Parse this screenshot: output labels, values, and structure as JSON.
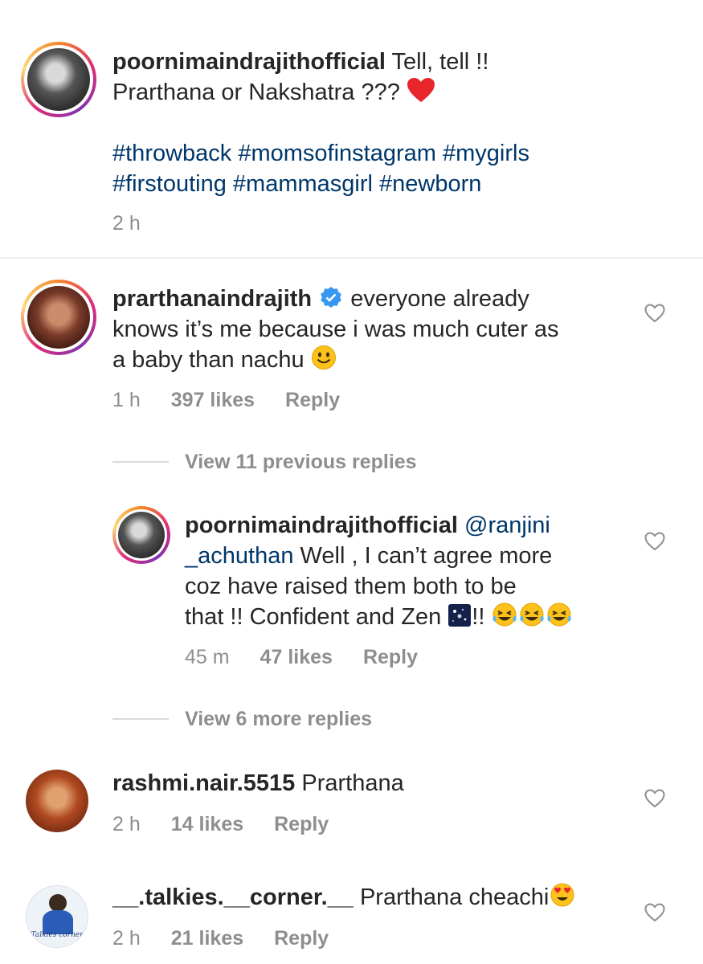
{
  "caption": {
    "username": "poornimaindrajithofficial",
    "text_line1": "Tell, tell !!",
    "text_line2": "Prarthana or Nakshatra ???",
    "hashtags_line1": "#throwback #momsofinstagram #mygirls",
    "hashtags_line2": "#firstouting #mammasgirl #newborn",
    "time": "2 h"
  },
  "comments": [
    {
      "username": "prarthanaindrajith",
      "verified": true,
      "line1": "everyone already",
      "line2": "knows it’s me because i was much cuter as",
      "line3": "a baby than nachu",
      "time": "1 h",
      "likes": "397 likes",
      "reply": "Reply",
      "view_replies": "View 11 previous replies"
    },
    {
      "username": "poornimaindrajithofficial",
      "mention_a": "@ranjini",
      "mention_b": "_achuthan",
      "line2": "Well , I can’t agree more",
      "line3": "coz have raised them both to be",
      "line4a": "that !! Confident and Zen",
      "line4b": "!!",
      "time": "45 m",
      "likes": "47 likes",
      "reply": "Reply",
      "view_replies": "View 6 more replies"
    },
    {
      "username": "rashmi.nair.5515",
      "text": "Prarthana",
      "time": "2 h",
      "likes": "14 likes",
      "reply": "Reply"
    },
    {
      "username": "__.talkies.__corner.__",
      "text": "Prarthana cheachi",
      "time": "2 h",
      "likes": "21 likes",
      "reply": "Reply",
      "avatar_text": "Talkies corner"
    }
  ],
  "colors": {
    "text": "#262626",
    "secondary": "#8e8e8e",
    "hashtag": "#00376b",
    "verified": "#3897f0",
    "heart_red": "#ed4956"
  }
}
